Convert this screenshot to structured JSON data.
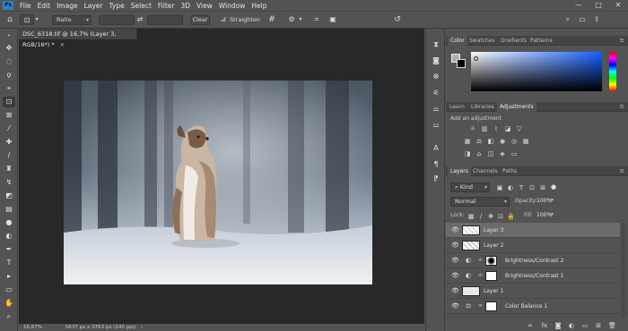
{
  "menu": {
    "logo": "Ps",
    "items": [
      "File",
      "Edit",
      "Image",
      "Layer",
      "Type",
      "Select",
      "Filter",
      "3D",
      "View",
      "Window",
      "Help"
    ]
  },
  "window_controls": {
    "minimize": "—",
    "maximize": "□",
    "close": "✕"
  },
  "options": {
    "ratio": "Ratio",
    "clear": "Clear",
    "straighten": "Straighten"
  },
  "document": {
    "tab_title": "DSC_6318.tif @ 16,7% (Layer 3, RGB/16*) *",
    "close": "×"
  },
  "status": {
    "zoom": "16,67%",
    "info": "5637 px x 3763 px (240 ppi)",
    "arrow": "›"
  },
  "color_panel": {
    "tabs": [
      "Color",
      "Swatches",
      "Gradients",
      "Patterns"
    ],
    "active_tab": "Color",
    "hue_color": "#1560ff"
  },
  "adjust_panel": {
    "tabs": [
      "Learn",
      "Libraries",
      "Adjustments"
    ],
    "active_tab": "Adjustments",
    "heading": "Add an adjustment"
  },
  "layers_panel": {
    "tabs": [
      "Layers",
      "Channels",
      "Paths"
    ],
    "active_tab": "Layers",
    "kind_filter": "Kind",
    "blend_mode": "Normal",
    "opacity_label": "Opacity:",
    "opacity_value": "100%",
    "lock_label": "Lock:",
    "fill_label": "Fill:",
    "fill_value": "100%",
    "layers": [
      {
        "name": "Layer 3",
        "active": true
      },
      {
        "name": "Layer 2",
        "active": false
      },
      {
        "name": "Brightness/Contrast 2",
        "active": false
      },
      {
        "name": "Brightness/Contrast 1",
        "active": false
      },
      {
        "name": "Layer 1",
        "active": false
      },
      {
        "name": "Color Balance 1",
        "active": false
      }
    ],
    "footer_icons": [
      "link-icon",
      "fx-icon",
      "mask-icon",
      "adjustment-icon",
      "folder-icon",
      "new-layer-icon",
      "trash-icon"
    ]
  }
}
